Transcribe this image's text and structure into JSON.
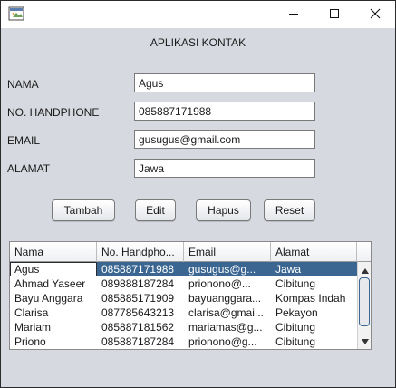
{
  "window": {
    "buttons": {
      "minimize": "minimize-icon",
      "maximize": "maximize-icon",
      "close": "close-icon"
    }
  },
  "form": {
    "heading": "APLIKASI KONTAK",
    "fields": [
      {
        "label": "NAMA",
        "value": "Agus"
      },
      {
        "label": "NO. HANDPHONE",
        "value": "085887171988"
      },
      {
        "label": "EMAIL",
        "value": "gusugus@gmail.com"
      },
      {
        "label": "ALAMAT",
        "value": "Jawa"
      }
    ]
  },
  "actions": {
    "add": "Tambah",
    "edit": "Edit",
    "delete": "Hapus",
    "reset": "Reset"
  },
  "table": {
    "columns": [
      "Nama",
      "No. Handpho...",
      "Email",
      "Alamat"
    ],
    "rows": [
      [
        "Agus",
        "085887171988",
        "gusugus@g...",
        "Jawa"
      ],
      [
        "Ahmad Yaseer",
        "089888187284",
        "prionono@...",
        "Cibitung"
      ],
      [
        "Bayu Anggara",
        "085885171909",
        "bayuanggara...",
        "Kompas Indah"
      ],
      [
        "Clarisa",
        "087785643213",
        "clarisa@gmai...",
        "Pekayon"
      ],
      [
        "Mariam",
        "085887181562",
        "mariamas@g...",
        "Cibitung"
      ],
      [
        "Priono",
        "085887187284",
        "prionono@g...",
        "Cibitung"
      ]
    ],
    "selected_row": 0,
    "selection_color": "#3a6691"
  }
}
